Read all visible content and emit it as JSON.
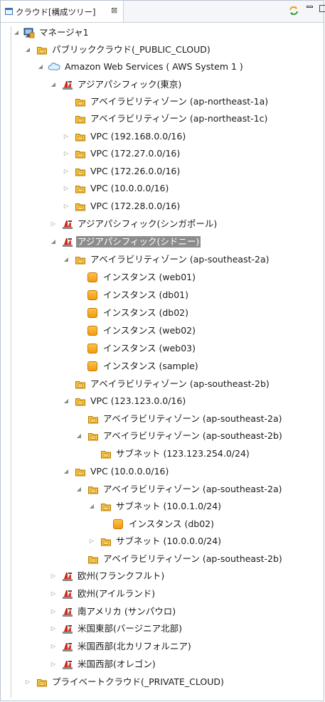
{
  "view": {
    "tab_title": "クラウド[構成ツリー]",
    "tab_close": "⊠"
  },
  "tree": {
    "manager": "マネージャ1",
    "public_cloud": "パブリッククラウド(_PUBLIC_CLOUD)",
    "aws": "Amazon Web Services ( AWS System 1 )",
    "tokyo": "アジアパシフィック(東京)",
    "az_ne1a": "アベイラビリティゾーン (ap-northeast-1a)",
    "az_ne1c": "アベイラビリティゾーン (ap-northeast-1c)",
    "vpc_192_168": "VPC (192.168.0.0/16)",
    "vpc_172_27": "VPC (172.27.0.0/16)",
    "vpc_172_26": "VPC (172.26.0.0/16)",
    "vpc_10_tokyo": "VPC (10.0.0.0/16)",
    "vpc_172_28": "VPC (172.28.0.0/16)",
    "singapore": "アジアパシフィック(シンガポール)",
    "sydney": "アジアパシフィック(シドニー)",
    "az_se2a": "アベイラビリティゾーン (ap-southeast-2a)",
    "inst_web01": "インスタンス (web01)",
    "inst_db01": "インスタンス (db01)",
    "inst_db02": "インスタンス (db02)",
    "inst_web02": "インスタンス (web02)",
    "inst_web03": "インスタンス (web03)",
    "inst_sample": "インスタンス (sample)",
    "az_se2b": "アベイラビリティゾーン (ap-southeast-2b)",
    "vpc_123": "VPC (123.123.0.0/16)",
    "vpc123_az_2a": "アベイラビリティゾーン (ap-southeast-2a)",
    "vpc123_az_2b": "アベイラビリティゾーン (ap-southeast-2b)",
    "subnet_123": "サブネット (123.123.254.0/24)",
    "vpc_10_sydney": "VPC (10.0.0.0/16)",
    "vpc10_az_2a": "アベイラビリティゾーン (ap-southeast-2a)",
    "subnet_10_0_1": "サブネット (10.0.1.0/24)",
    "subnet_inst_db02": "インスタンス (db02)",
    "subnet_10_0_0": "サブネット (10.0.0.0/24)",
    "vpc10_az_2b": "アベイラビリティゾーン (ap-southeast-2b)",
    "frankfurt": "欧州(フランクフルト)",
    "ireland": "欧州(アイルランド)",
    "sao_paulo": "南アメリカ (サンパウロ)",
    "virginia": "米国東部(バージニア北部)",
    "california": "米国西部(北カリフォルニア)",
    "oregon": "米国西部(オレゴン)",
    "private_cloud": "プライベートクラウド(_PRIVATE_CLOUD)"
  },
  "icons": {
    "manager": "manager-icon",
    "folder": "folder-icon",
    "aws_cloud": "cloud-icon",
    "region": "region-icon",
    "instance": "instance-icon",
    "sync": "sync-icon",
    "expanded": "expanded-triangle",
    "collapsed": "collapsed-triangle"
  },
  "colors": {
    "selection": "#8c8c8c",
    "folder": "#e8a317",
    "instance": "#f29a0e",
    "region": "#c8281e"
  }
}
